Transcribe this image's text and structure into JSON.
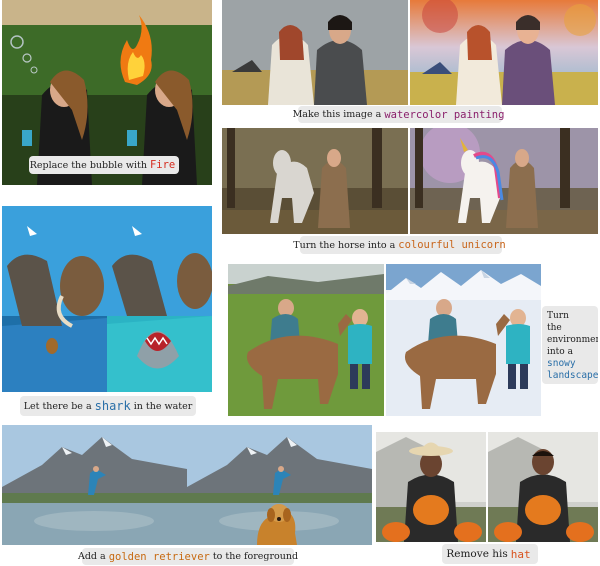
{
  "captions": {
    "fire": {
      "before": "Replace the bubble with",
      "highlight": "Fire",
      "after": ""
    },
    "watercolor": {
      "before": "Make this image a",
      "highlight": "watercolor painting",
      "after": ""
    },
    "unicorn": {
      "before": "Turn the horse into a",
      "highlight": "colourful unicorn",
      "after": ""
    },
    "shark": {
      "before": "Let there be a",
      "highlight": "shark",
      "after": "in the water"
    },
    "snow": {
      "line1": "Turn",
      "line2": "the",
      "line3": "environment",
      "line4": "into a",
      "highlight1": "snowy",
      "highlight2": "landscape"
    },
    "retriever": {
      "before": "Add a",
      "highlight": "golden retriever",
      "after": "to the foreground"
    },
    "hat": {
      "before": "Remove his",
      "highlight": "hat",
      "after": ""
    }
  },
  "colors": {
    "fire": "#d52b1e",
    "watercolor": "#8a1f6b",
    "unicorn": "#c9661c",
    "shark": "#2a6fa8",
    "snow": "#2a6fa8",
    "retriever": "#c76a12",
    "hat": "#d9531e",
    "caption_bg": "#e9e9e9"
  }
}
